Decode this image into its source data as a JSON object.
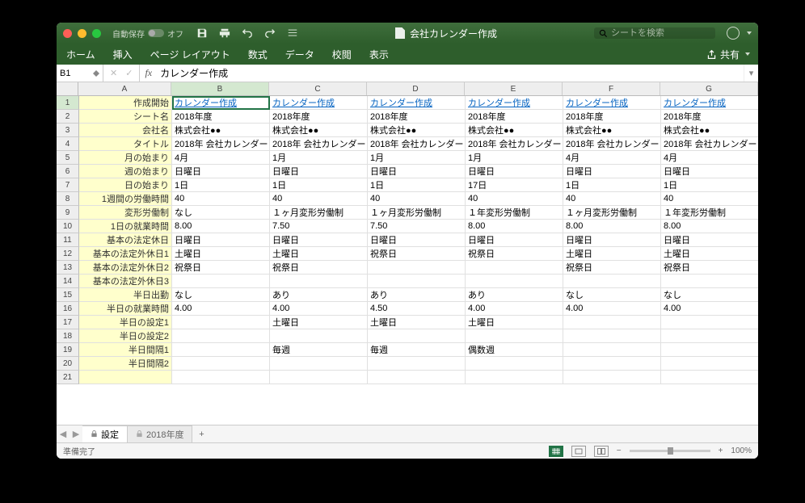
{
  "autosave_label": "自動保存",
  "autosave_state": "オフ",
  "document_title": "会社カレンダー作成",
  "search_placeholder": "シートを検索",
  "tabs": {
    "home": "ホーム",
    "insert": "挿入",
    "page_layout": "ページ レイアウト",
    "formulas": "数式",
    "data": "データ",
    "review": "校閲",
    "view": "表示",
    "share": "共有"
  },
  "name_box": "B1",
  "formula_value": "カレンダー作成",
  "columns": [
    "A",
    "B",
    "C",
    "D",
    "E",
    "F",
    "G"
  ],
  "row_headers": [
    "1",
    "2",
    "3",
    "4",
    "5",
    "6",
    "7",
    "8",
    "9",
    "10",
    "11",
    "12",
    "13",
    "14",
    "15",
    "16",
    "17",
    "18",
    "19",
    "20",
    "21"
  ],
  "colA": [
    "作成開始",
    "シート名",
    "会社名",
    "タイトル",
    "月の始まり",
    "週の始まり",
    "日の始まり",
    "1週間の労働時間",
    "変形労働制",
    "1日の就業時間",
    "基本の法定休日",
    "基本の法定外休日1",
    "基本の法定外休日2",
    "基本の法定外休日3",
    "半日出勤",
    "半日の就業時間",
    "半日の設定1",
    "半日の設定2",
    "半日間隔1",
    "半日間隔2"
  ],
  "link_text": "カレンダー作成",
  "dataRows": [
    [
      "2018年度",
      "2018年度",
      "2018年度",
      "2018年度",
      "2018年度",
      "2018年度"
    ],
    [
      "株式会社●●",
      "株式会社●●",
      "株式会社●●",
      "株式会社●●",
      "株式会社●●",
      "株式会社●●"
    ],
    [
      "2018年 会社カレンダー",
      "2018年 会社カレンダー",
      "2018年 会社カレンダー",
      "2018年 会社カレンダー",
      "2018年 会社カレンダー",
      "2018年 会社カレンダー"
    ],
    [
      "4月",
      "1月",
      "1月",
      "1月",
      "4月",
      "4月"
    ],
    [
      "日曜日",
      "日曜日",
      "日曜日",
      "日曜日",
      "日曜日",
      "日曜日"
    ],
    [
      "1日",
      "1日",
      "1日",
      "17日",
      "1日",
      "1日"
    ],
    [
      "40",
      "40",
      "40",
      "40",
      "40",
      "40"
    ],
    [
      "なし",
      "１ヶ月変形労働制",
      "１ヶ月変形労働制",
      "１年変形労働制",
      "１ヶ月変形労働制",
      "１年変形労働制"
    ],
    [
      "8.00",
      "7.50",
      "7.50",
      "8.00",
      "8.00",
      "8.00"
    ],
    [
      "日曜日",
      "日曜日",
      "日曜日",
      "日曜日",
      "日曜日",
      "日曜日"
    ],
    [
      "土曜日",
      "土曜日",
      "祝祭日",
      "祝祭日",
      "土曜日",
      "土曜日"
    ],
    [
      "祝祭日",
      "祝祭日",
      "",
      "",
      "祝祭日",
      "祝祭日"
    ],
    [
      "",
      "",
      "",
      "",
      "",
      ""
    ],
    [
      "なし",
      "あり",
      "あり",
      "あり",
      "なし",
      "なし"
    ],
    [
      "4.00",
      "4.00",
      "4.50",
      "4.00",
      "4.00",
      "4.00"
    ],
    [
      "",
      "土曜日",
      "土曜日",
      "土曜日",
      "",
      ""
    ],
    [
      "",
      "",
      "",
      "",
      "",
      ""
    ],
    [
      "",
      "毎週",
      "毎週",
      "偶数週",
      "",
      ""
    ],
    [
      "",
      "",
      "",
      "",
      "",
      ""
    ]
  ],
  "sheet_tabs": {
    "active": "設定",
    "inactive": "2018年度"
  },
  "status_ready": "準備完了",
  "zoom": "100%"
}
